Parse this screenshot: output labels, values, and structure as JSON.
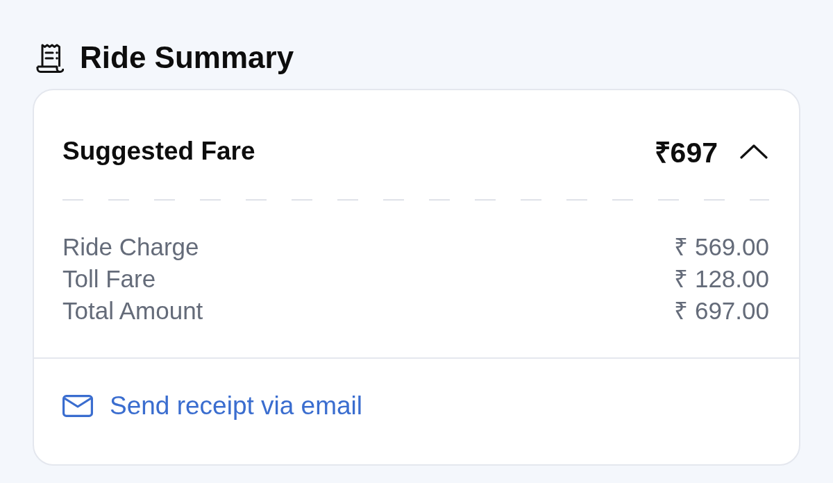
{
  "header": {
    "title": "Ride Summary"
  },
  "fare": {
    "label": "Suggested Fare",
    "amount": "₹697",
    "expanded": true,
    "breakdown": [
      {
        "label": "Ride Charge",
        "amount": "₹ 569.00"
      },
      {
        "label": "Toll Fare",
        "amount": "₹ 128.00"
      },
      {
        "label": "Total Amount",
        "amount": "₹ 697.00"
      }
    ]
  },
  "receipt_link": {
    "label": "Send receipt via email"
  }
}
